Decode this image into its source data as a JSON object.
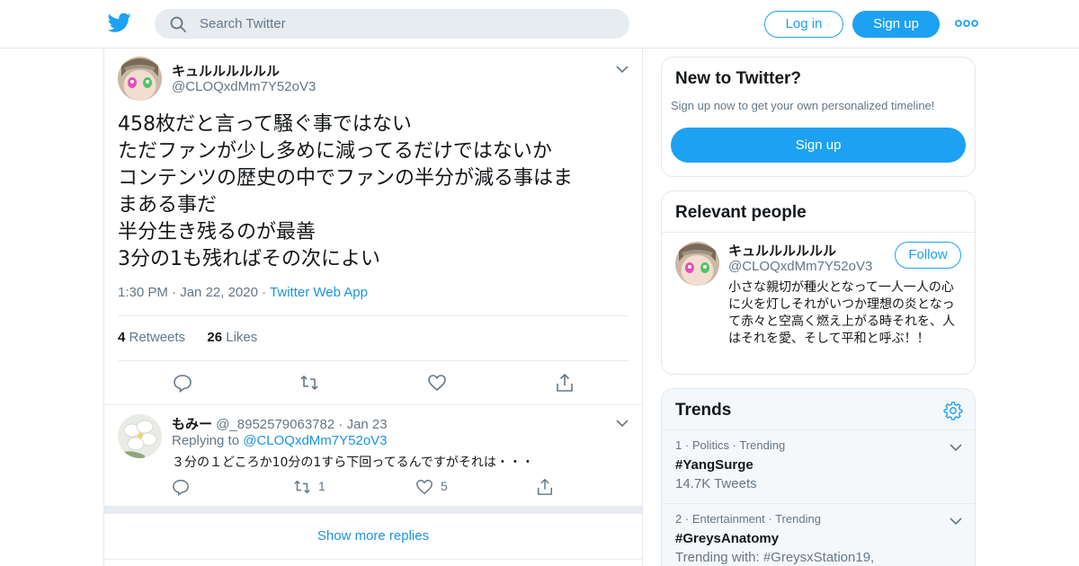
{
  "header": {
    "search_placeholder": "Search Twitter",
    "login_label": "Log in",
    "signup_label": "Sign up",
    "logo_icon": "twitter-bird-icon",
    "more_icon": "more-dots-icon",
    "brand_color": "#1da1f2"
  },
  "tweet": {
    "author_name": "キュルルルルルル",
    "author_handle": "@CLOQxdMm7Y52oV3",
    "lines": [
      "458枚だと言って騒ぐ事ではない",
      "ただファンが少し多めに減ってるだけではないか",
      "コンテンツの歴史の中でファンの半分が減る事はま",
      "まある事だ",
      "半分生き残るのが最善",
      "3分の1も残ればその次によい"
    ],
    "time": "1:30 PM",
    "date": "Jan 22, 2020",
    "source": "Twitter Web App",
    "retweets_count": "4",
    "retweets_label": "Retweets",
    "likes_count": "26",
    "likes_label": "Likes"
  },
  "reply": {
    "author_name": "もみー",
    "author_handle": "@_8952579063782",
    "date": "Jan 23",
    "replying_prefix": "Replying to",
    "replying_to": "@CLOQxdMm7Y52oV3",
    "text": "３分の１どころか10分の1すら下回ってるんですがそれは・・・",
    "retweets": "1",
    "likes": "5"
  },
  "show_more_replies": "Show more replies",
  "sidebar": {
    "new_title": "New to Twitter?",
    "new_subtitle": "Sign up now to get your own personalized timeline!",
    "new_button": "Sign up",
    "relevant_title": "Relevant people",
    "person": {
      "name": "キュルルルルルル",
      "handle": "@CLOQxdMm7Y52oV3",
      "follow_label": "Follow",
      "bio": "小さな親切が種火となって一人一人の心に火を灯しそれがいつか理想の炎となって赤々と空高く燃え上がる時それを、人はそれを愛、そして平和と呼ぶ！！"
    },
    "trends_title": "Trends",
    "trends": [
      {
        "rank": "1",
        "category": "Politics",
        "status": "Trending",
        "name": "#YangSurge",
        "sub": "14.7K Tweets"
      },
      {
        "rank": "2",
        "category": "Entertainment",
        "status": "Trending",
        "name": "#GreysAnatomy",
        "sub": "Trending with: #GreysxStation19,"
      }
    ]
  }
}
